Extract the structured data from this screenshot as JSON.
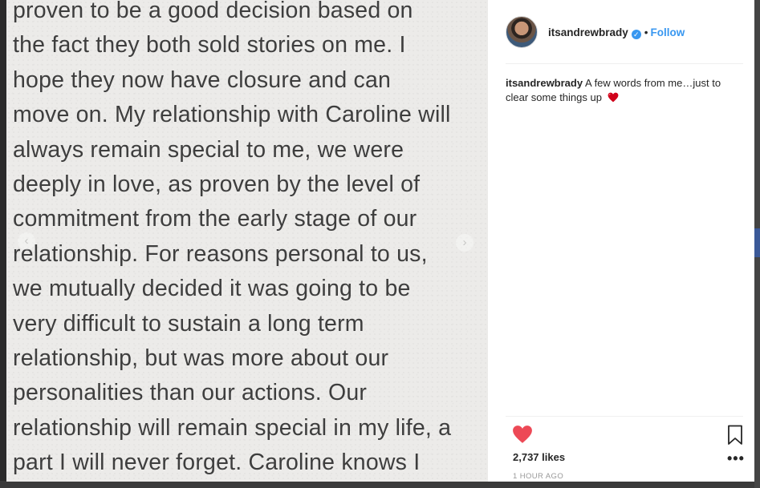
{
  "post": {
    "note_lines": [
      "proven to be a good decision based on",
      "the fact they both sold stories on me. I",
      "hope they now have closure and can",
      "move on. My relationship with Caroline will",
      "always remain special to me, we were",
      "deeply in love, as proven by the level of",
      "commitment from the early stage of our",
      "relationship. For reasons personal to us,",
      "we mutually decided it was going to be",
      "very difficult to sustain a long term",
      "relationship, but was more about our",
      "personalities than our actions. Our",
      "relationship will remain special in my life, a",
      "part I will never forget. Caroline knows I"
    ],
    "prev_arrow": "‹",
    "next_arrow": "›"
  },
  "header": {
    "username": "itsandrewbrady",
    "verified_glyph": "✓",
    "separator": "•",
    "follow_label": "Follow"
  },
  "caption": {
    "username": "itsandrewbrady",
    "text": "A few words from me…just to clear some things up"
  },
  "stats": {
    "likes": "2,737 likes",
    "timestamp": "1 HOUR AGO"
  },
  "icons": {
    "like": "heart-icon",
    "save": "bookmark-icon",
    "more": "more-icon",
    "emoji": "red-heart-emoji"
  },
  "colors": {
    "like_red": "#ed4956",
    "link_blue": "#3897f0",
    "text": "#262626",
    "muted": "#999999",
    "photo_bg": "#ecebe9"
  }
}
